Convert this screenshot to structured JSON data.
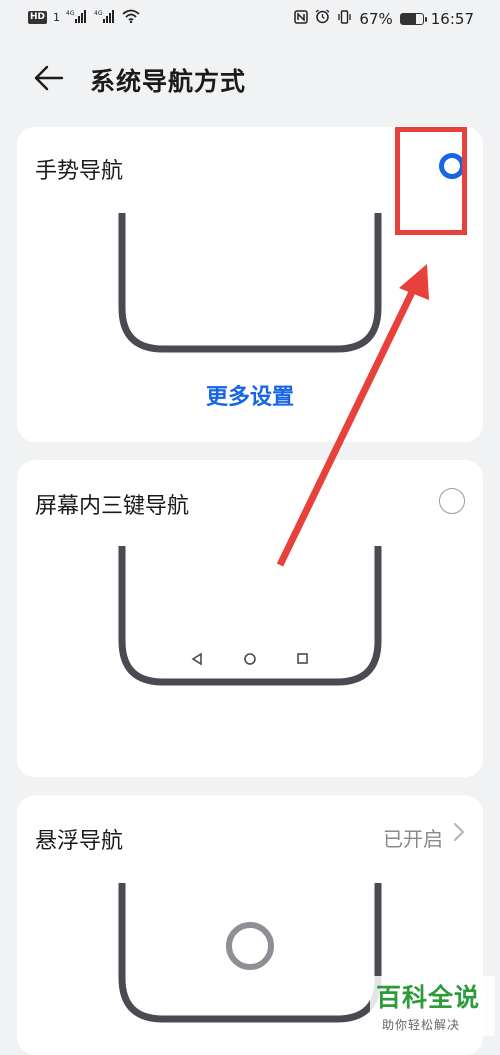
{
  "status_bar": {
    "left_badge": "HD",
    "sim1": "1",
    "net1": "4G",
    "net2": "4G",
    "battery_percent_text": "67%",
    "battery_level": 0.67,
    "time": "16:57"
  },
  "header": {
    "back_icon": "arrow-left-icon",
    "title": "系统导航方式"
  },
  "options": [
    {
      "title": "手势导航",
      "selected": true,
      "link": "更多设置"
    },
    {
      "title": "屏幕内三键导航",
      "selected": false,
      "nav_icons": [
        "back-triangle-icon",
        "home-circle-icon",
        "recent-square-icon"
      ]
    },
    {
      "title": "悬浮导航",
      "status": "已开启",
      "chevron": "chevron-right-icon"
    }
  ],
  "annotation": {
    "box_color": "#e8403a",
    "arrow_color": "#e8403a"
  },
  "watermark": {
    "main": "百科全说",
    "sub": "助你轻松解决"
  },
  "colors": {
    "accent": "#1565e6",
    "background": "#f1f2f4",
    "card": "#ffffff",
    "phone_outline": "#4a4b52",
    "watermark_green": "#2e9b3a"
  }
}
